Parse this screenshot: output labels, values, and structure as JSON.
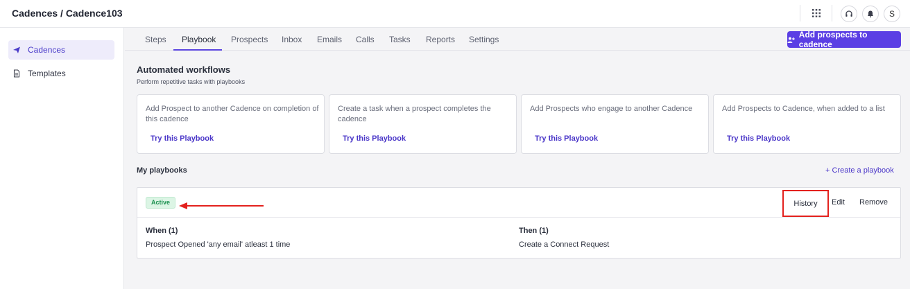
{
  "header": {
    "breadcrumb": "Cadences / Cadence103",
    "avatar_initial": "S"
  },
  "sidebar": {
    "items": [
      {
        "label": "Cadences",
        "icon": "paper-plane-icon",
        "active": true
      },
      {
        "label": "Templates",
        "icon": "document-icon",
        "active": false
      }
    ]
  },
  "tabs": [
    {
      "label": "Steps"
    },
    {
      "label": "Playbook",
      "active": true
    },
    {
      "label": "Prospects"
    },
    {
      "label": "Inbox"
    },
    {
      "label": "Emails"
    },
    {
      "label": "Calls"
    },
    {
      "label": "Tasks"
    },
    {
      "label": "Reports"
    },
    {
      "label": "Settings"
    }
  ],
  "add_prospects_label": "Add prospects to cadence",
  "automated": {
    "title": "Automated workflows",
    "subtitle": "Perform repetitive tasks with playbooks",
    "cards": [
      {
        "desc": "Add Prospect to another Cadence on completion of this cadence",
        "cta": "Try this Playbook"
      },
      {
        "desc": "Create a task when a prospect completes the cadence",
        "cta": "Try this Playbook"
      },
      {
        "desc": "Add Prospects who engage to another Cadence",
        "cta": "Try this Playbook"
      },
      {
        "desc": "Add Prospects to Cadence, when added to a list",
        "cta": "Try this Playbook"
      }
    ]
  },
  "my_playbooks": {
    "title": "My playbooks",
    "create_label": "+ Create a playbook",
    "playbook": {
      "status": "Active",
      "status_color": "#1d9150",
      "actions": {
        "history": "History",
        "edit": "Edit",
        "remove": "Remove"
      },
      "when_title": "When (1)",
      "when_text": "Prospect Opened 'any email' atleast 1 time",
      "then_title": "Then (1)",
      "then_text": "Create a Connect Request"
    }
  },
  "colors": {
    "accent": "#5b3fe4",
    "highlight": "#e3211d"
  }
}
